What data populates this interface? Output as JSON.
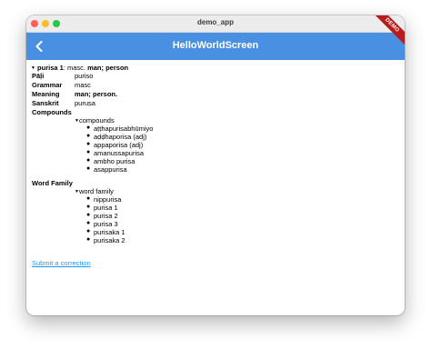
{
  "window": {
    "title": "demo_app"
  },
  "appbar": {
    "title": "HelloWorldScreen",
    "debug_banner": "DEMO"
  },
  "entry": {
    "headword": "purisa 1",
    "summary_pos": "masc.",
    "summary_meaning": "man; person",
    "rows": [
      {
        "label": "Pāḷi",
        "value": "puriso",
        "value_bold": false
      },
      {
        "label": "Grammar",
        "value": "masc",
        "value_bold": false
      },
      {
        "label": "Meaning",
        "value": "man; person.",
        "value_bold": true
      },
      {
        "label": "Sanskrit",
        "value": "puruṣa",
        "value_bold": false
      }
    ]
  },
  "compounds": {
    "heading": "Compounds",
    "toggle_label": "compounds",
    "items": [
      "aṭṭhapurisabhūmiyo",
      "aḍḍhaporisa (adj)",
      "appaporisa (adj)",
      "amanussapurisa",
      "ambho purisa",
      "asappurisa"
    ]
  },
  "word_family": {
    "heading": "Word Family",
    "toggle_label": "word family",
    "items": [
      "nippurisa",
      "purisa 1",
      "purisa 2",
      "purisa 3",
      "purisaka 1",
      "purisaka 2"
    ]
  },
  "footer": {
    "correction_link": "Submit a correction"
  }
}
